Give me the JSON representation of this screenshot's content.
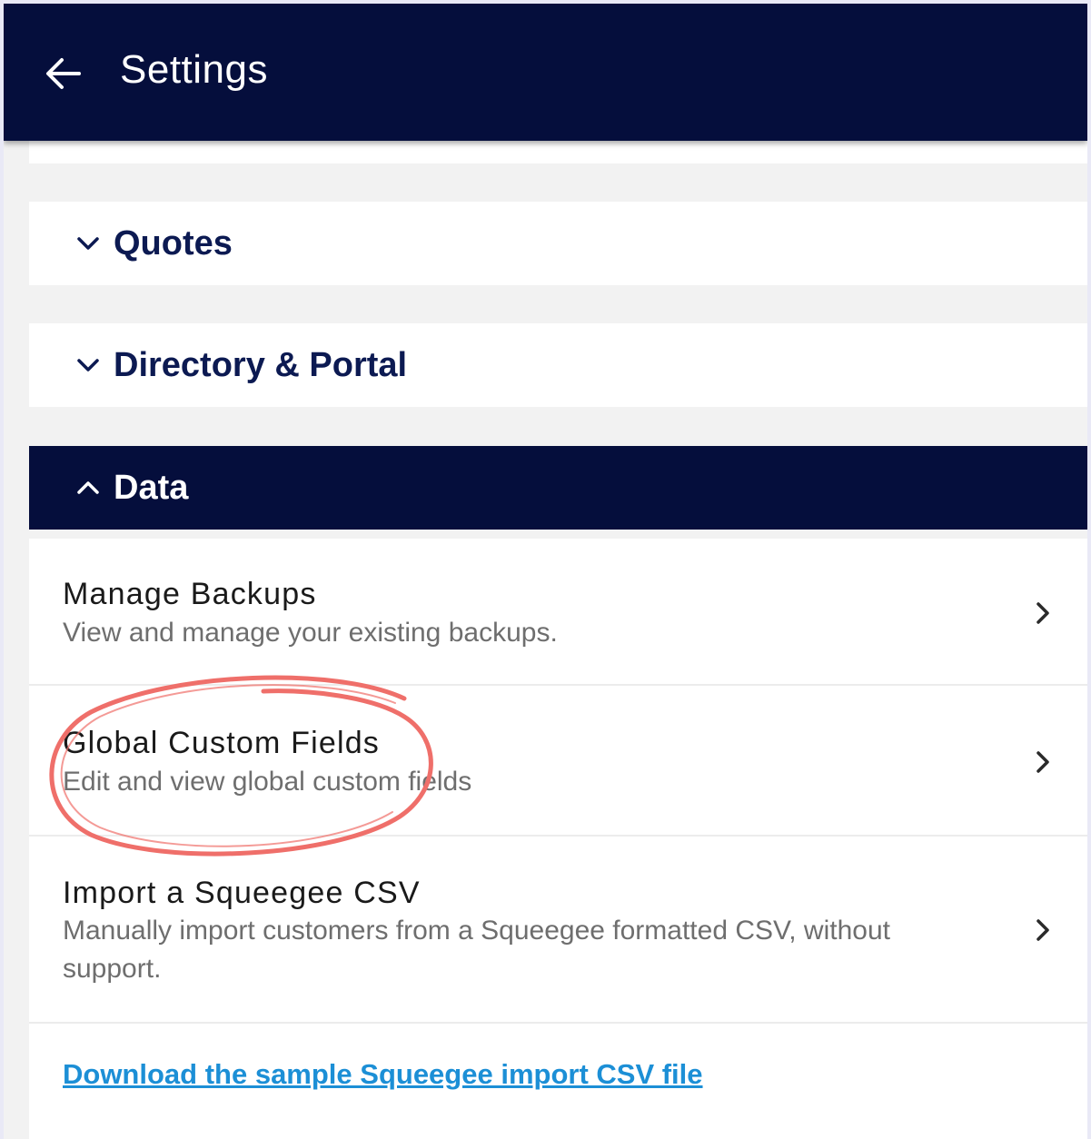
{
  "header": {
    "title": "Settings",
    "back_icon": "arrow-left-icon",
    "background": "#050e3c"
  },
  "panels": [
    {
      "label": "Quotes",
      "expanded": false,
      "icon": "chevron-down-icon"
    },
    {
      "label": "Directory & Portal",
      "expanded": false,
      "icon": "chevron-down-icon"
    },
    {
      "label": "Data",
      "expanded": true,
      "icon": "chevron-up-icon"
    }
  ],
  "data_items": [
    {
      "title": "Manage Backups",
      "description": "View and manage your existing backups.",
      "icon": "chevron-right-icon"
    },
    {
      "title": "Global Custom Fields",
      "description": "Edit and view global custom fields",
      "icon": "chevron-right-icon",
      "highlighted": true
    },
    {
      "title": "Import a Squeegee CSV",
      "description": "Manually import customers from a Squeegee formatted CSV, without support.",
      "icon": "chevron-right-icon"
    }
  ],
  "download_link": "Download the sample Squeegee import CSV file",
  "colors": {
    "navy": "#050e3c",
    "panel_text": "#0c1a52",
    "link": "#1c8fd6",
    "annotation": "#ef6f6a"
  }
}
